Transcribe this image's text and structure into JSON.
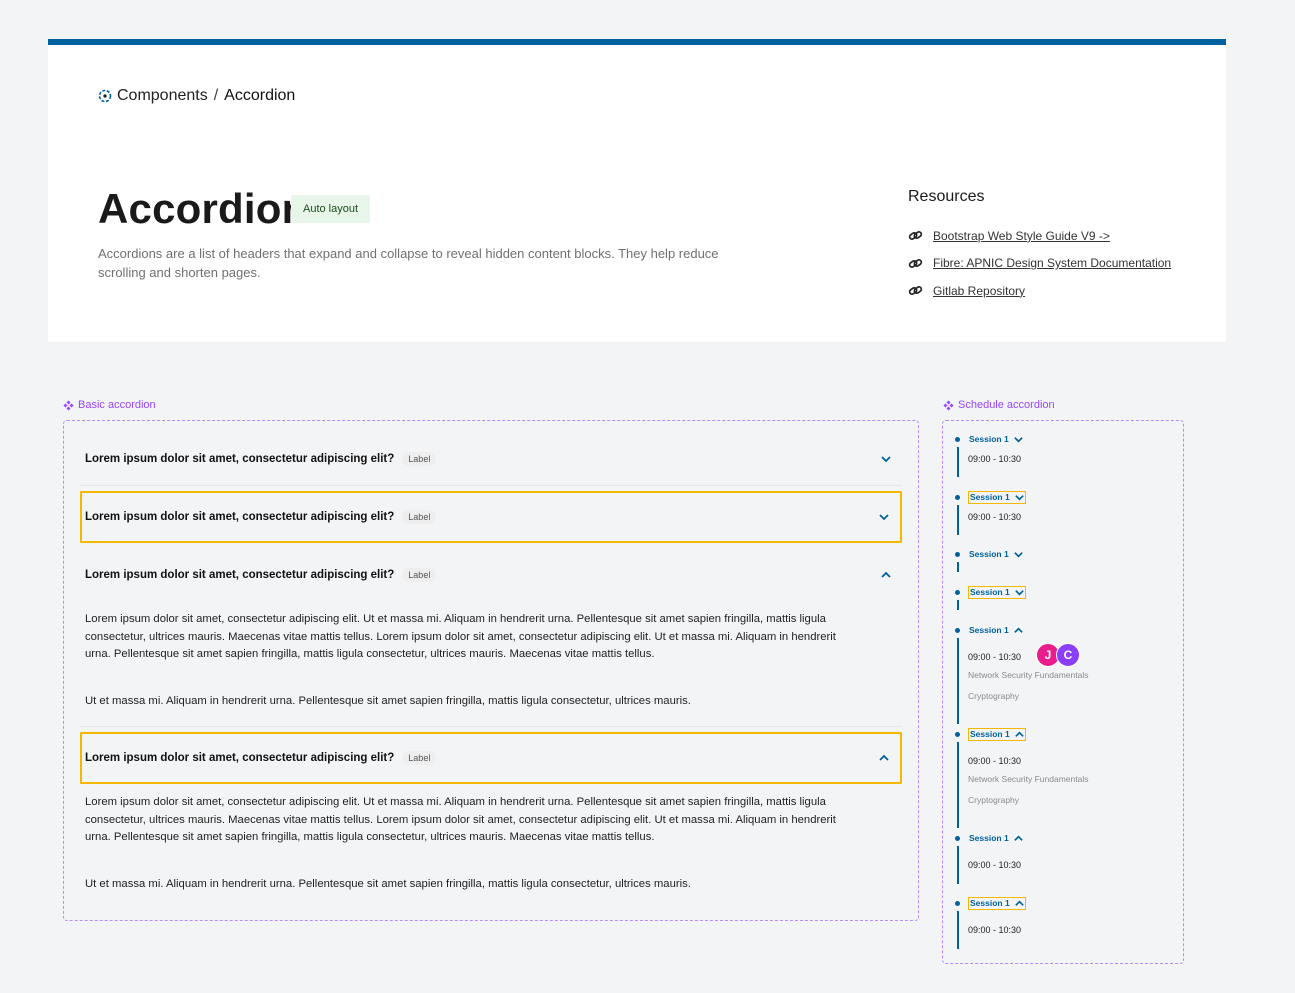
{
  "breadcrumb": {
    "parent": "Components",
    "separator": "/",
    "current": "Accordion"
  },
  "header": {
    "title": "Accordion",
    "badge": "Auto layout",
    "description": "Accordions are a list of headers that expand and collapse to reveal hidden content blocks. They help reduce scrolling and shorten pages."
  },
  "resources": {
    "title": "Resources",
    "links": [
      "Bootstrap Web Style Guide V9 ->",
      "Fibre: APNIC Design System Documentation",
      "Gitlab Repository"
    ]
  },
  "basic": {
    "section_label": "Basic accordion",
    "items": [
      {
        "question": "Lorem ipsum dolor sit amet, consectetur adipiscing elit?",
        "label": "Label",
        "expanded": false
      },
      {
        "question": "Lorem ipsum dolor sit amet, consectetur adipiscing elit?",
        "label": "Label",
        "expanded": false
      },
      {
        "question": "Lorem ipsum dolor sit amet, consectetur adipiscing elit?",
        "label": "Label",
        "expanded": true,
        "p1": "Lorem ipsum dolor sit amet, consectetur adipiscing elit. Ut et massa mi. Aliquam in hendrerit urna. Pellentesque sit amet sapien fringilla, mattis ligula consectetur, ultrices mauris. Maecenas vitae mattis tellus. Lorem ipsum dolor sit amet, consectetur adipiscing elit. Ut et massa mi. Aliquam in hendrerit urna. Pellentesque sit amet sapien fringilla, mattis ligula consectetur, ultrices mauris. Maecenas vitae mattis tellus.",
        "p2": "Ut et massa mi. Aliquam in hendrerit urna. Pellentesque sit amet sapien fringilla, mattis ligula consectetur, ultrices mauris."
      },
      {
        "question": "Lorem ipsum dolor sit amet, consectetur adipiscing elit?",
        "label": "Label",
        "expanded": true,
        "p1": "Lorem ipsum dolor sit amet, consectetur adipiscing elit. Ut et massa mi. Aliquam in hendrerit urna. Pellentesque sit amet sapien fringilla, mattis ligula consectetur, ultrices mauris. Maecenas vitae mattis tellus. Lorem ipsum dolor sit amet, consectetur adipiscing elit. Ut et massa mi. Aliquam in hendrerit urna. Pellentesque sit amet sapien fringilla, mattis ligula consectetur, ultrices mauris. Maecenas vitae mattis tellus.",
        "p2": "Ut et massa mi. Aliquam in hendrerit urna. Pellentesque sit amet sapien fringilla, mattis ligula consectetur, ultrices mauris."
      }
    ]
  },
  "schedule": {
    "section_label": "Schedule accordion",
    "session": "Session 1",
    "time": "09:00 - 10:30",
    "topic1": "Network Security Fundamentals",
    "topic2": "Cryptography"
  },
  "avatars": [
    "J",
    "C"
  ],
  "colors": {
    "accent": "#00619f",
    "highlight": "#f5b800",
    "component": "#9747ff"
  }
}
